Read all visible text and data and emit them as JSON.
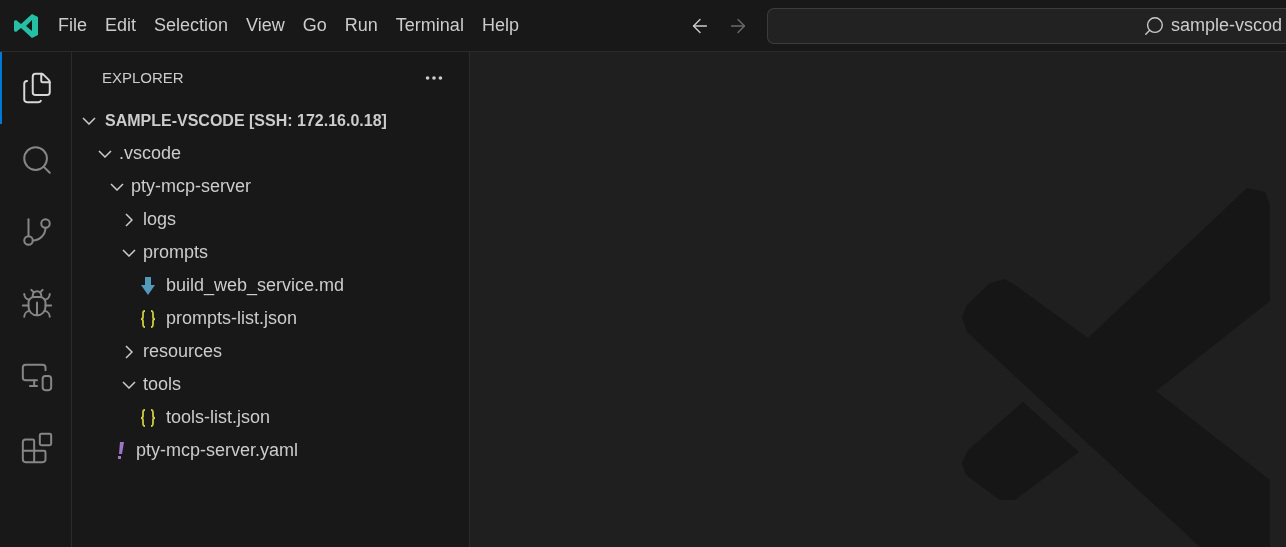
{
  "menu": [
    "File",
    "Edit",
    "Selection",
    "View",
    "Go",
    "Run",
    "Terminal",
    "Help"
  ],
  "navigation": [
    {
      "kind": "back",
      "disabled": false
    },
    {
      "kind": "forward",
      "disabled": true
    }
  ],
  "search": {
    "value": "sample-vscod"
  },
  "activity_bar": [
    {
      "kind": "explorer",
      "selected": true
    },
    {
      "kind": "search",
      "selected": false
    },
    {
      "kind": "source-control",
      "selected": false
    },
    {
      "kind": "run-debug",
      "selected": false
    },
    {
      "kind": "remote",
      "selected": false
    },
    {
      "kind": "extensions",
      "selected": false
    }
  ],
  "sidebar": {
    "title": "EXPLORER",
    "root": {
      "label": "SAMPLE-VSCODE [SSH: 172.16.0.18]",
      "expanded": true,
      "children": [
        {
          "label": ".vscode",
          "kind": "folder",
          "expanded": true,
          "children": [
            {
              "label": "pty-mcp-server",
              "kind": "folder",
              "expanded": true,
              "children": [
                {
                  "label": "logs",
                  "kind": "folder",
                  "expanded": false
                },
                {
                  "label": "prompts",
                  "kind": "folder",
                  "expanded": true,
                  "children": [
                    {
                      "label": "build_web_service.md",
                      "kind": "markdown"
                    },
                    {
                      "label": "prompts-list.json",
                      "kind": "json"
                    }
                  ]
                },
                {
                  "label": "resources",
                  "kind": "folder",
                  "expanded": false
                },
                {
                  "label": "tools",
                  "kind": "folder",
                  "expanded": true,
                  "children": [
                    {
                      "label": "tools-list.json",
                      "kind": "json"
                    }
                  ]
                }
              ]
            },
            {
              "label": "pty-mcp-server.yaml",
              "kind": "yaml"
            }
          ]
        }
      ]
    }
  }
}
